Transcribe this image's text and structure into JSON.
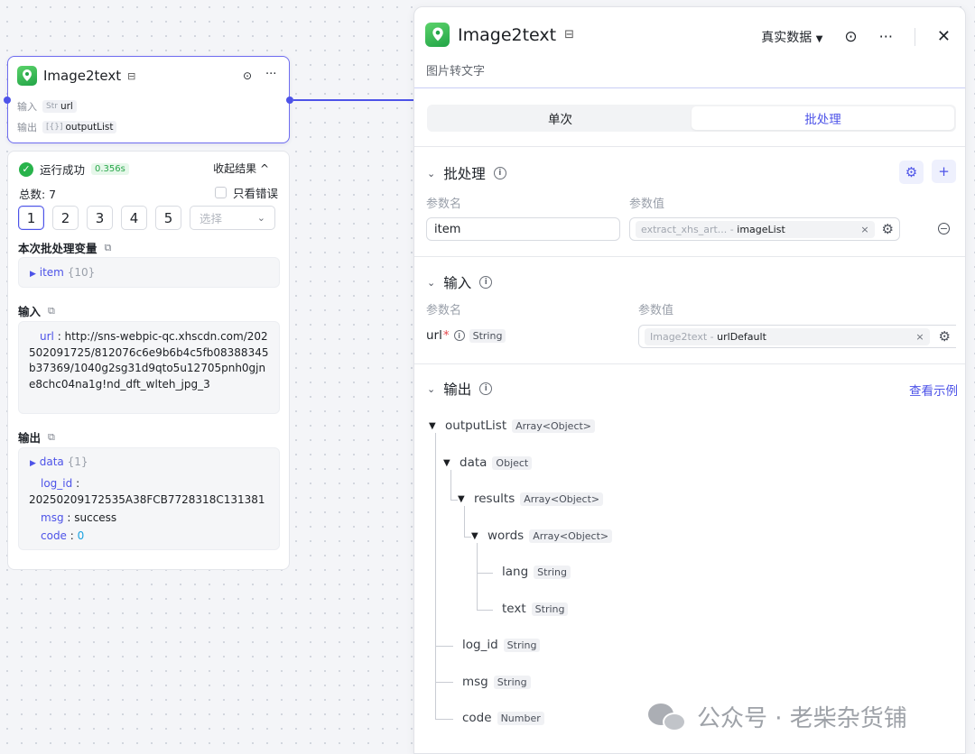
{
  "node": {
    "title": "Image2text",
    "input_label": "输入",
    "input_type": "Str",
    "input_value": "url",
    "output_label": "输出",
    "output_type": "[{}]",
    "output_value": "outputList"
  },
  "result": {
    "status": "运行成功",
    "time": "0.356s",
    "collapse": "收起结果 ^",
    "total": "总数: 7",
    "errors_only": "只看错误",
    "pages": [
      "1",
      "2",
      "3",
      "4",
      "5"
    ],
    "select_placeholder": "选择",
    "batch_var_title": "本次批处理变量",
    "batch_item_key": "item",
    "batch_item_count": "{10}",
    "input_title": "输入",
    "input_url_key": "url",
    "input_url_value": "http://sns-webpic-qc.xhscdn.com/202502091725/812076c6e9b6b4c5fb08388345b37369/1040g2sg31d9qto5u12705pnh0gjne8chc04na1g!nd_dft_wlteh_jpg_3",
    "output_title": "输出",
    "output_data_key": "data",
    "output_data_count": "{1}",
    "log_id_key": "log_id",
    "log_id_value": "20250209172535A38FCB7728318C131381",
    "msg_key": "msg",
    "msg_value": "success",
    "code_key": "code",
    "code_value": "0"
  },
  "panel": {
    "title": "Image2text",
    "subtitle": "图片转文字",
    "data_mode": "真实数据",
    "tabs": [
      "单次",
      "批处理"
    ],
    "active_tab": 1,
    "batch": {
      "title": "批处理",
      "col_name": "参数名",
      "col_value": "参数值",
      "param_name": "item",
      "ref_source": "extract_xhs_art...",
      "ref_sep": " - ",
      "ref_field": "imageList"
    },
    "input": {
      "title": "输入",
      "col_name": "参数名",
      "col_value": "参数值",
      "param_name": "url",
      "required_mark": "*",
      "param_type": "String",
      "ref_source": "Image2text",
      "ref_sep": " - ",
      "ref_field": "urlDefault"
    },
    "output": {
      "title": "输出",
      "example_link": "查看示例",
      "tree": [
        {
          "name": "outputList",
          "type": "Array<Object>"
        },
        {
          "name": "data",
          "type": "Object"
        },
        {
          "name": "results",
          "type": "Array<Object>"
        },
        {
          "name": "words",
          "type": "Array<Object>"
        },
        {
          "name": "lang",
          "type": "String"
        },
        {
          "name": "text",
          "type": "String"
        },
        {
          "name": "log_id",
          "type": "String"
        },
        {
          "name": "msg",
          "type": "String"
        },
        {
          "name": "code",
          "type": "Number"
        }
      ]
    }
  },
  "watermark": "公众号 · 老柴杂货铺",
  "colors": {
    "accent": "#4d53e8",
    "success": "#28b34b",
    "brand_icon": "#22a447"
  }
}
